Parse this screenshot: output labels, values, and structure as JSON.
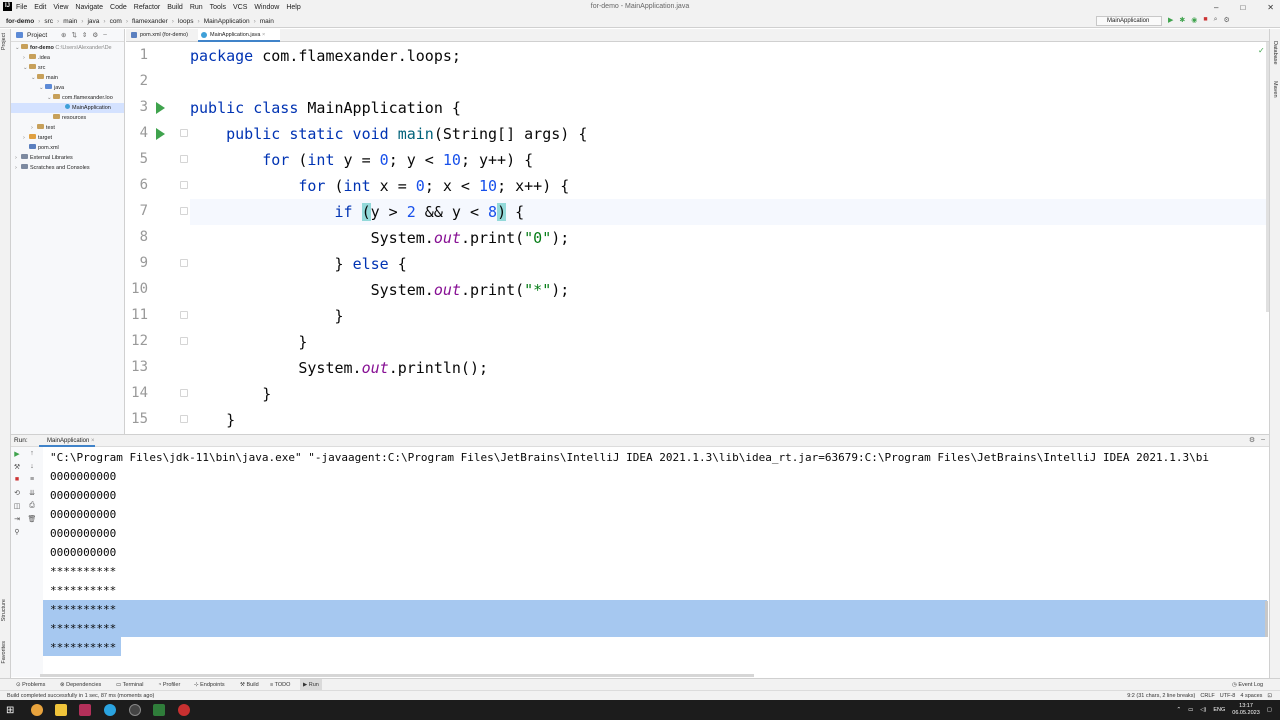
{
  "titlebar": {
    "menu": [
      "File",
      "Edit",
      "View",
      "Navigate",
      "Code",
      "Refactor",
      "Build",
      "Run",
      "Tools",
      "VCS",
      "Window",
      "Help"
    ],
    "window_title": "for-demo - MainApplication.java"
  },
  "breadcrumb": [
    "for-demo",
    "src",
    "main",
    "java",
    "com",
    "flamexander",
    "loops",
    "MainApplication",
    "main"
  ],
  "run_config": "MainApplication",
  "project_panel": {
    "title": "Project",
    "tree": [
      {
        "label": "for-demo",
        "extra": "C:\\Users\\Alexander\\De"
      },
      {
        "label": ".idea"
      },
      {
        "label": "src"
      },
      {
        "label": "main"
      },
      {
        "label": "java"
      },
      {
        "label": "com.flamexander.loo"
      },
      {
        "label": "MainApplication"
      },
      {
        "label": "resources"
      },
      {
        "label": "test"
      },
      {
        "label": "target"
      },
      {
        "label": "pom.xml"
      },
      {
        "label": "External Libraries"
      },
      {
        "label": "Scratches and Consoles"
      }
    ]
  },
  "tabs": [
    {
      "label": "pom.xml (for-demo)"
    },
    {
      "label": "MainApplication.java"
    }
  ],
  "editor": {
    "line_numbers": [
      "1",
      "2",
      "3",
      "4",
      "5",
      "6",
      "7",
      "8",
      "9",
      "10",
      "11",
      "12",
      "13",
      "14",
      "15"
    ]
  },
  "run_panel": {
    "label": "Run:",
    "tab": "MainApplication",
    "command": "\"C:\\Program Files\\jdk-11\\bin\\java.exe\" \"-javaagent:C:\\Program Files\\JetBrains\\IntelliJ IDEA 2021.1.3\\lib\\idea_rt.jar=63679:C:\\Program Files\\JetBrains\\IntelliJ IDEA 2021.1.3\\bi",
    "output": [
      "0000000000",
      "0000000000",
      "0000000000",
      "0000000000",
      "0000000000",
      "**********",
      "**********",
      "**********",
      "**********",
      "**********"
    ]
  },
  "bottom_tools": [
    "Problems",
    "Dependencies",
    "Terminal",
    "Profiler",
    "Endpoints",
    "Build",
    "TODO",
    "Run"
  ],
  "event_log": "Event Log",
  "status": {
    "message": "Build completed successfully in 1 sec, 87 ms (moments ago)",
    "position": "9:2 (31 chars, 2 line breaks)",
    "line_sep": "CRLF",
    "encoding": "UTF-8",
    "indent": "4 spaces"
  },
  "taskbar": {
    "lang": "ENG",
    "time": "13:17",
    "date": "06.05.2023"
  },
  "side_labels": {
    "left_top": "Project",
    "left_structure": "Structure",
    "left_favorites": "Favorites",
    "right_database": "Database",
    "right_maven": "Maven"
  }
}
